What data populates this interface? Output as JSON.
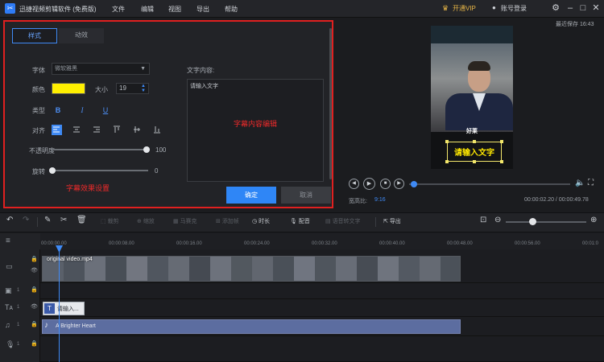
{
  "titlebar": {
    "app_title": "迅捷视频剪辑软件 (免费版)",
    "menu": [
      "文件",
      "编辑",
      "视图",
      "导出",
      "帮助"
    ],
    "vip_label": "开通VIP",
    "login_label": "账号登录"
  },
  "editor": {
    "tabs": [
      {
        "label": "样式"
      },
      {
        "label": "动效"
      }
    ],
    "font_label": "字体",
    "font_value": "微软雅黑",
    "color_label": "颜色",
    "color_value": "#ffef00",
    "size_label": "大小",
    "size_value": "19",
    "type_label": "类型",
    "type_buttons": [
      "B",
      "I",
      "U"
    ],
    "align_label": "对齐",
    "opacity_label": "不透明度",
    "opacity_value": "100",
    "rotation_label": "旋转",
    "rotation_value": "0",
    "content_label": "文字内容:",
    "content_value": "请输入文字",
    "center_hint": "字幕内容编辑",
    "bottom_hint": "字幕效果设置",
    "ok_label": "确定",
    "cancel_label": "取消"
  },
  "preview": {
    "saved_label": "最近保存 16:43",
    "video_caption": "好莱",
    "subtitle_text": "请输入文字",
    "aspect_label": "宽高比:",
    "aspect_value": "9:16",
    "time_label": "00:00:02.20 / 00:00:49.78",
    "progress_fraction": 0.02
  },
  "toolbar": {
    "crop": "裁剪",
    "zoom": "缩放",
    "mosaic": "马赛克",
    "add_frame": "添加帧",
    "duration": "时长",
    "dub": "配音",
    "speech_to_text": "语音转文字",
    "export": "导出"
  },
  "timeline": {
    "ticks": [
      "00:00:00.00",
      "00:00:08.00",
      "00:00:16.00",
      "00:00:24.00",
      "00:00:32.00",
      "00:00:40.00",
      "00:00:48.00",
      "00:00:56.00",
      "00:01:0"
    ],
    "track_numbers": [
      "1",
      "1",
      "1",
      "1"
    ],
    "video_clip_label": "original video.mp4",
    "subtitle_clip_label": "请输入...",
    "audio_clip_label": "A Brighter Heart"
  },
  "colors": {
    "accent": "#3f8af5",
    "highlight_border": "#e02020",
    "subtitle_yellow": "#ffe800"
  }
}
